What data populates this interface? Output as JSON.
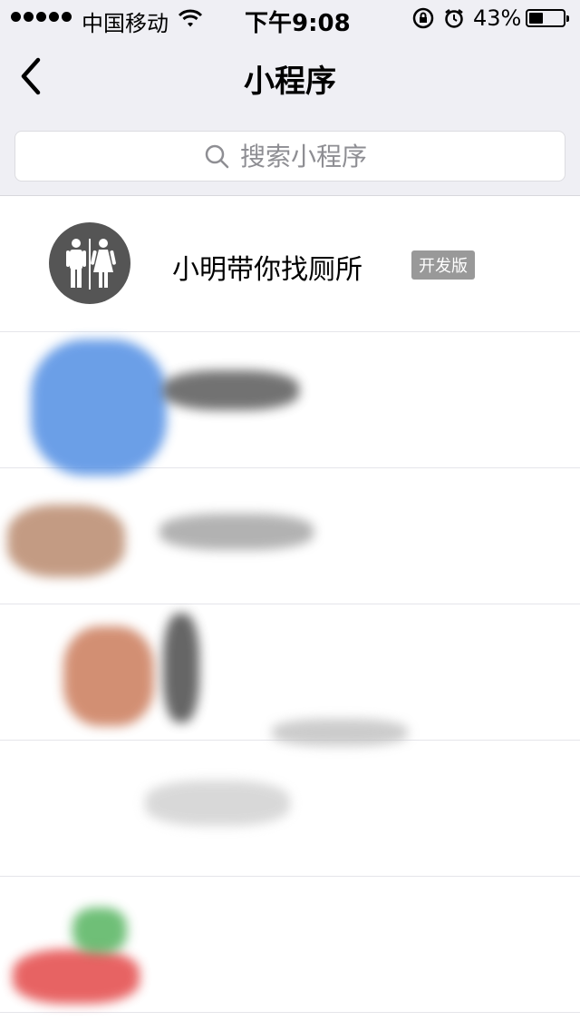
{
  "status_bar": {
    "carrier": "中国移动",
    "time": "下午9:08",
    "battery": "43%",
    "battery_level": 0.43
  },
  "nav": {
    "title": "小程序",
    "back_icon": "chevron-left-icon"
  },
  "search": {
    "placeholder": "搜索小程序",
    "icon": "search-icon"
  },
  "apps": [
    {
      "name": "小明带你找厕所",
      "badge": "开发版",
      "icon": "restroom-icon"
    }
  ],
  "colors": {
    "nav_bg": "#efeff4",
    "avatar_bg": "#555555",
    "badge_bg": "#999999",
    "placeholder": "#8e8e93"
  }
}
